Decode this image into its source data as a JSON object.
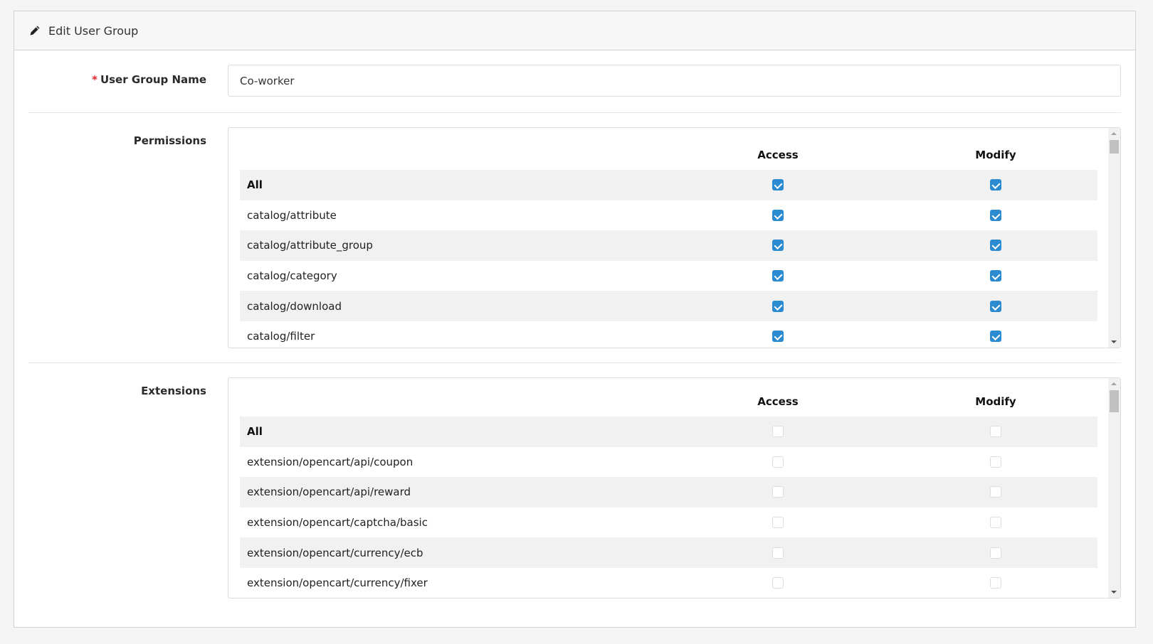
{
  "header": {
    "title": "Edit User Group",
    "icon": "pencil-icon"
  },
  "form": {
    "name_label": "User Group Name",
    "required_marker": "*",
    "name_value": "Co-worker",
    "permissions_label": "Permissions",
    "extensions_label": "Extensions"
  },
  "permissions": {
    "columns": [
      "Access",
      "Modify"
    ],
    "rows": [
      {
        "name": "All",
        "access": true,
        "modify": true
      },
      {
        "name": "catalog/attribute",
        "access": true,
        "modify": true
      },
      {
        "name": "catalog/attribute_group",
        "access": true,
        "modify": true
      },
      {
        "name": "catalog/category",
        "access": true,
        "modify": true
      },
      {
        "name": "catalog/download",
        "access": true,
        "modify": true
      },
      {
        "name": "catalog/filter",
        "access": true,
        "modify": true
      }
    ],
    "scroll_position": 0
  },
  "extensions": {
    "columns": [
      "Access",
      "Modify"
    ],
    "rows": [
      {
        "name": "All",
        "access": false,
        "modify": false
      },
      {
        "name": "extension/opencart/api/coupon",
        "access": false,
        "modify": false
      },
      {
        "name": "extension/opencart/api/reward",
        "access": false,
        "modify": false
      },
      {
        "name": "extension/opencart/captcha/basic",
        "access": false,
        "modify": false
      },
      {
        "name": "extension/opencart/currency/ecb",
        "access": false,
        "modify": false
      },
      {
        "name": "extension/opencart/currency/fixer",
        "access": false,
        "modify": false
      }
    ],
    "scroll_position": 0
  },
  "colors": {
    "checkbox_checked": "#2a8bd1",
    "required": "#e3262d"
  }
}
